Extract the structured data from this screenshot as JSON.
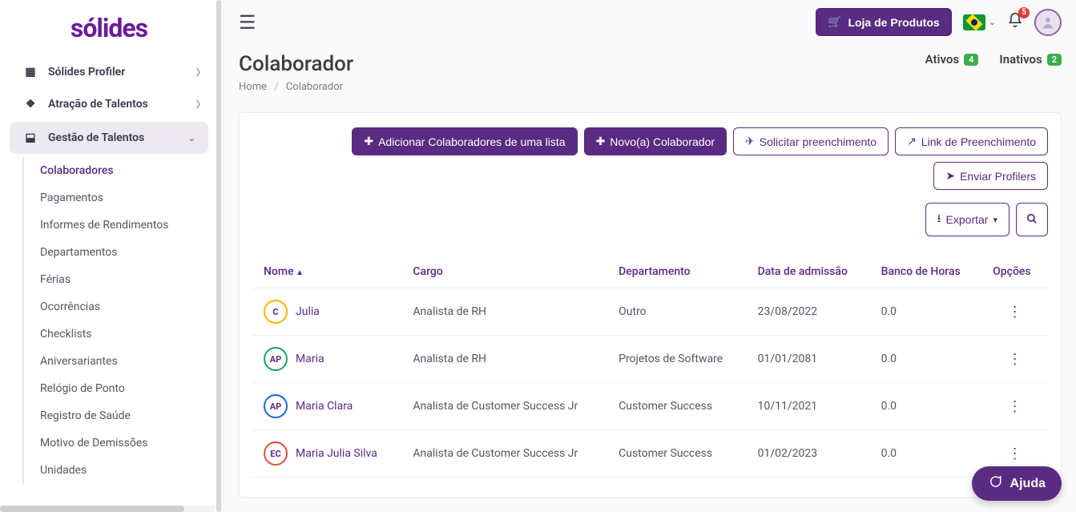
{
  "brand": "sólides",
  "header": {
    "store_btn": "Loja de Produtos",
    "notif_count": "5"
  },
  "sidebar": {
    "profiler": {
      "label": "Sólides Profiler"
    },
    "talent_attraction": {
      "label": "Atração de Talentos"
    },
    "talent_mgmt": {
      "label": "Gestão de Talentos"
    },
    "sub": {
      "colaboradores": "Colaboradores",
      "pagamentos": "Pagamentos",
      "informes": "Informes de Rendimentos",
      "departamentos": "Departamentos",
      "ferias": "Férias",
      "ocorrencias": "Ocorrências",
      "checklists": "Checklists",
      "aniversariantes": "Aniversariantes",
      "relogio": "Relógio de Ponto",
      "saude": "Registro de Saúde",
      "demissoes": "Motivo de Demissões",
      "unidades": "Unidades"
    }
  },
  "page": {
    "title": "Colaborador",
    "crumb_home": "Home",
    "crumb_current": "Colaborador",
    "tab_active": "Ativos",
    "tab_active_count": "4",
    "tab_inactive": "Inativos",
    "tab_inactive_count": "2"
  },
  "buttons": {
    "add_from_list": "Adicionar Colaboradores de uma lista",
    "new_colab": "Novo(a) Colaborador",
    "request_fill": "Solicitar preenchimento",
    "fill_link": "Link de Preenchimento",
    "send_profilers": "Enviar Profilers",
    "export": "Exportar"
  },
  "table": {
    "cols": {
      "nome": "Nome",
      "cargo": "Cargo",
      "departamento": "Departamento",
      "admissao": "Data de admissão",
      "banco": "Banco de Horas",
      "opcoes": "Opções"
    },
    "rows": [
      {
        "initials": "C",
        "ring": "#f5b700",
        "name": "Julia",
        "cargo": "Analista de RH",
        "dept": "Outro",
        "date": "23/08/2022",
        "banco": "0.0"
      },
      {
        "initials": "AP",
        "ring": "#1aa36a",
        "name": "Maria",
        "cargo": "Analista de RH",
        "dept": "Projetos de Software",
        "date": "01/01/2081",
        "banco": "0.0"
      },
      {
        "initials": "AP",
        "ring": "#1a66d6",
        "name": "Maria Clara",
        "cargo": "Analista de Customer Success Jr",
        "dept": "Customer Success",
        "date": "10/11/2021",
        "banco": "0.0"
      },
      {
        "initials": "EC",
        "ring": "#e0503a",
        "name": "Maria Julia Silva",
        "cargo": "Analista de Customer Success Jr",
        "dept": "Customer Success",
        "date": "01/02/2023",
        "banco": "0.0"
      }
    ]
  },
  "help": "Ajuda"
}
